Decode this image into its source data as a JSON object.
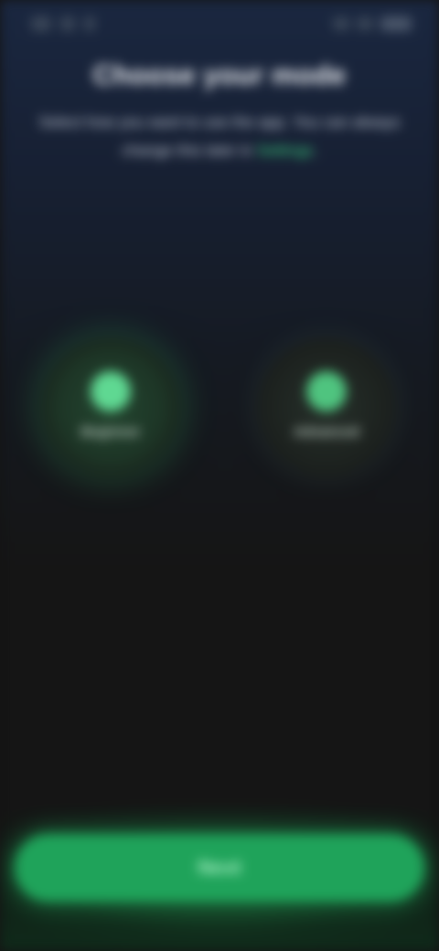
{
  "status_bar": {
    "left_icons": [
      "signal-icon",
      "notification-icon",
      "notification-icon"
    ],
    "right_icons": [
      "wifi-icon",
      "network-icon",
      "battery-icon"
    ]
  },
  "header": {
    "title": "Choose your mode",
    "description_pre": "Select how you want to use the app. You can always change this later in",
    "description_accent": "Settings",
    "description_post": "."
  },
  "options": [
    {
      "label": "Beginner",
      "icon": "leaf-icon",
      "selected": true
    },
    {
      "label": "Advanced",
      "icon": "bolt-icon",
      "selected": false
    }
  ],
  "cta": {
    "label": "Next"
  },
  "colors": {
    "accent": "#3ddc84",
    "button": "#1fa35a",
    "background": "#151515"
  }
}
